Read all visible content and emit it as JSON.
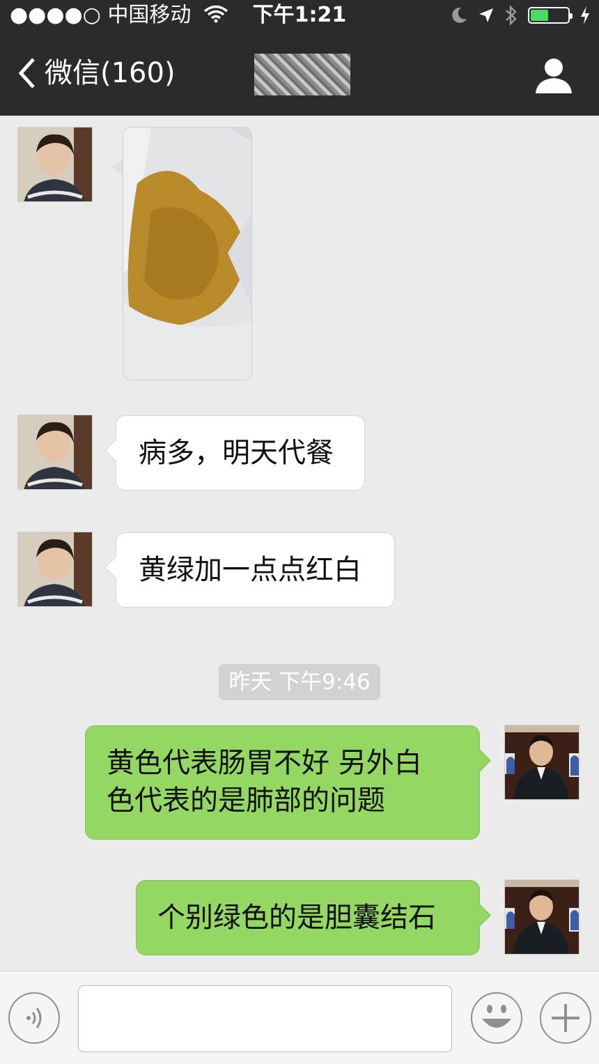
{
  "status_bar": {
    "signal": "●●●●○",
    "carrier": "中国移动",
    "time": "下午1:21"
  },
  "nav": {
    "back_label": "微信(160)"
  },
  "messages": [
    {
      "side": "in",
      "type": "image"
    },
    {
      "side": "in",
      "type": "text",
      "text": "病多，明天代餐"
    },
    {
      "side": "in",
      "type": "text",
      "text": "黄绿加一点点红白"
    },
    {
      "type": "timestamp",
      "text": "昨天 下午9:46"
    },
    {
      "side": "out",
      "type": "text",
      "lines": [
        "黄色代表肠胃不好 另外白",
        "色代表的是肺部的问题"
      ]
    },
    {
      "side": "out",
      "type": "text",
      "text": "个别绿色的是胆囊结石"
    }
  ],
  "toolbar": {
    "input_value": "",
    "icons": [
      "voice-icon",
      "emoji-icon",
      "plus-icon"
    ]
  },
  "colors": {
    "bar_background": "#2b2b2d",
    "chat_background": "#ebebeb",
    "outgoing_bubble": "#94d863",
    "incoming_bubble": "#ffffff",
    "battery_level": "#4cd964"
  }
}
